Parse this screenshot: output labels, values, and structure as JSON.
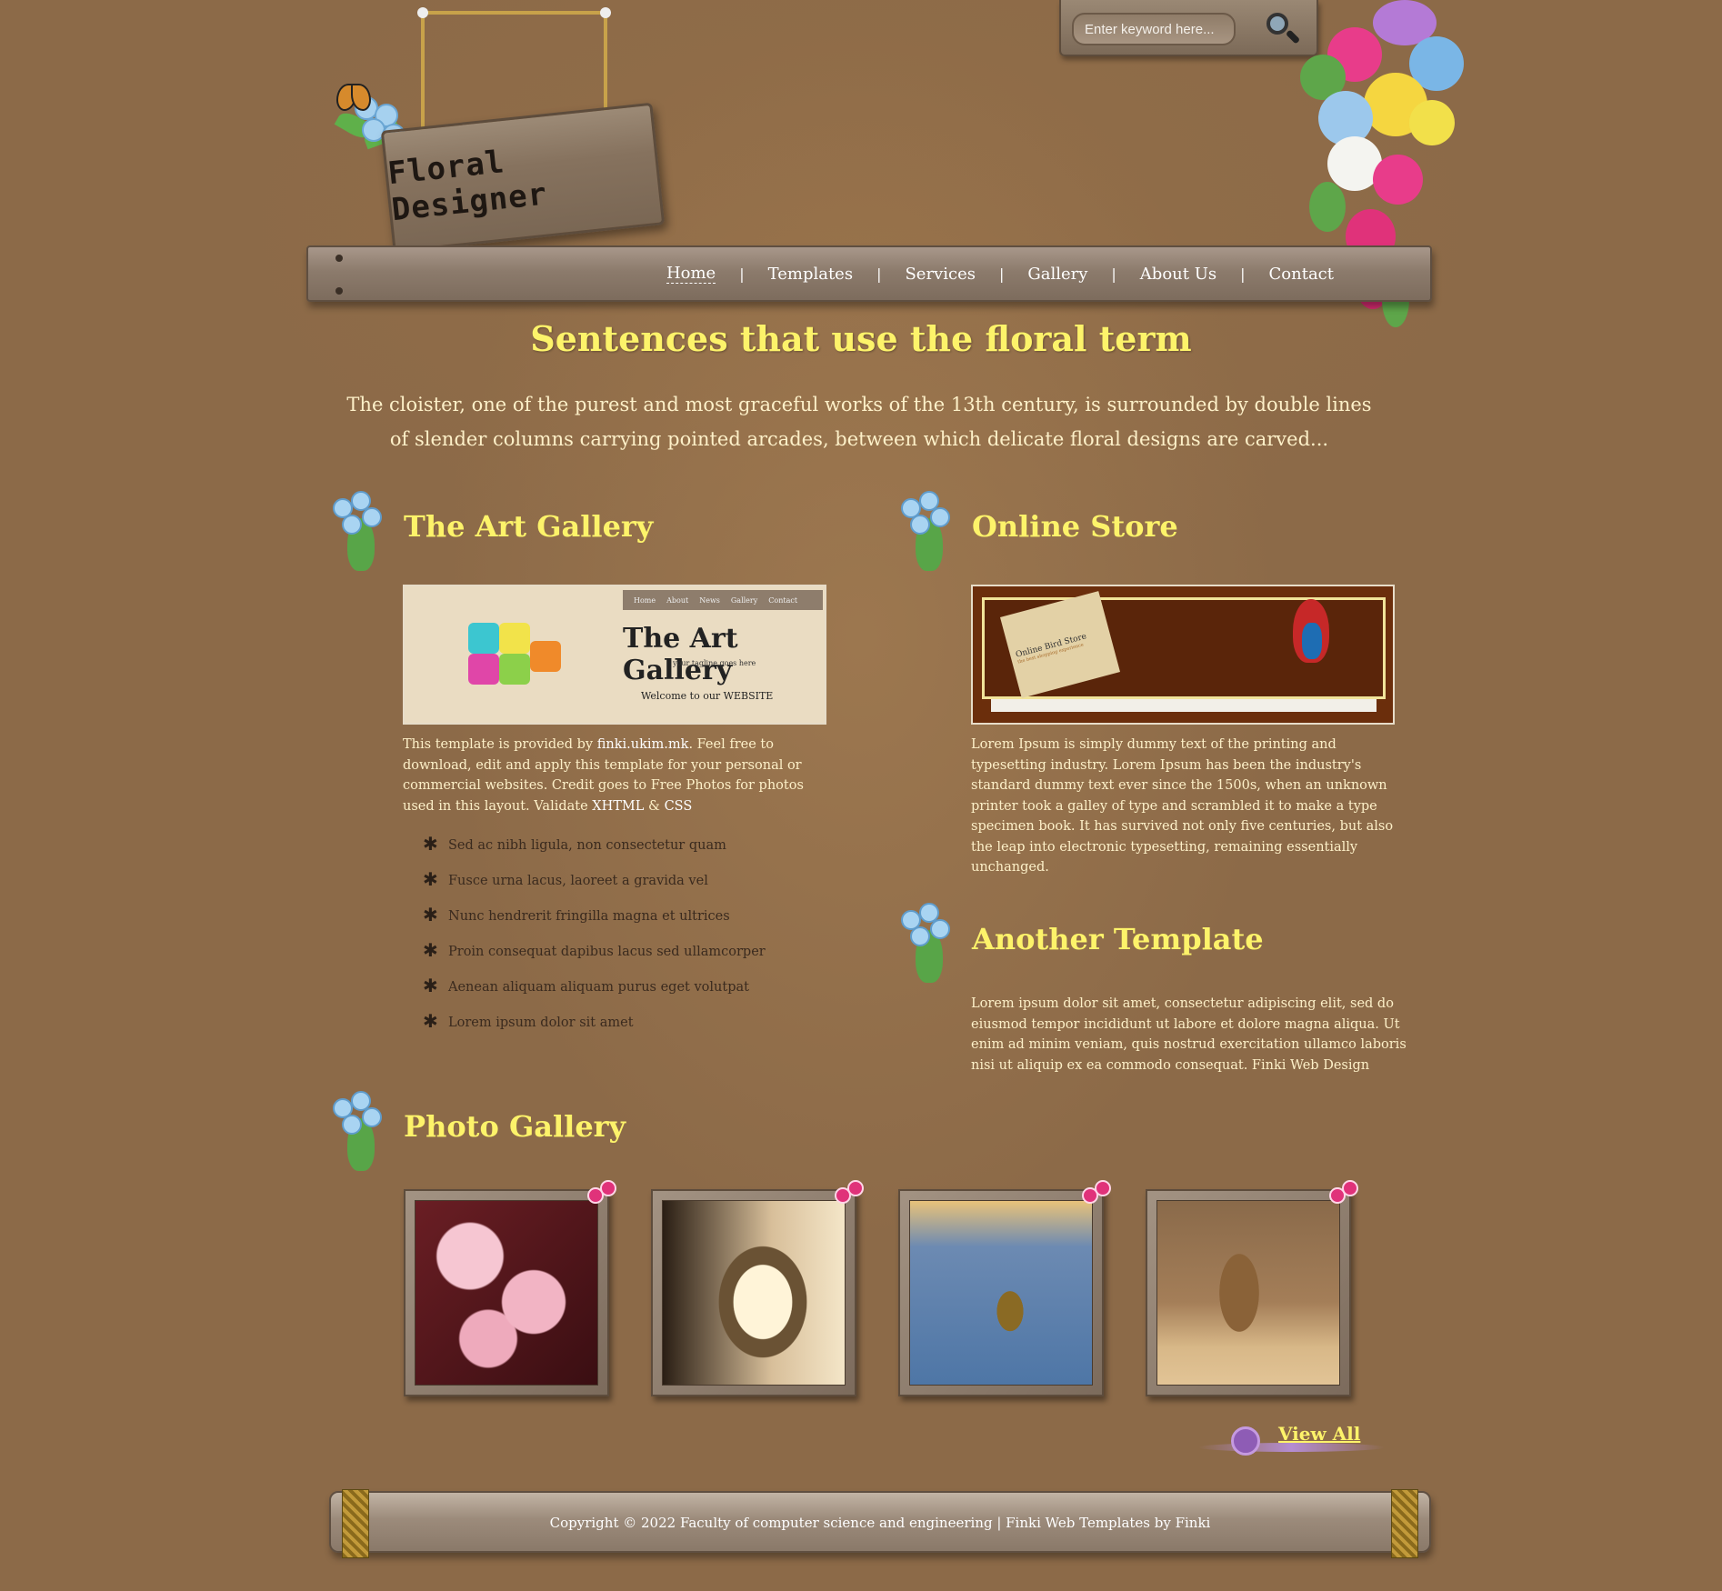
{
  "header": {
    "logo_text": "Floral Designer",
    "search_placeholder": "Enter keyword here...",
    "nav": [
      {
        "label": "Home",
        "active": true
      },
      {
        "label": "Templates"
      },
      {
        "label": "Services"
      },
      {
        "label": "Gallery"
      },
      {
        "label": "About Us"
      },
      {
        "label": "Contact"
      }
    ]
  },
  "intro": {
    "title": "Sentences that use the floral term",
    "text": "The cloister, one of the purest and most graceful works of the 13th century, is surrounded by double lines of slender columns carrying pointed arcades, between which delicate floral designs are carved..."
  },
  "art_gallery": {
    "title": "The Art Gallery",
    "thumb_title": "The Art Gallery",
    "thumb_tagline": "your tagline goes here",
    "thumb_welcome": "Welcome to our WEBSITE",
    "thumb_menu": [
      "Home",
      "About",
      "News",
      "Gallery",
      "Contact"
    ],
    "para_before": "This template is provided by ",
    "para_link": "finki.ukim.mk",
    "para_after": ". Feel free to download, edit and apply this template for your personal or commercial websites. Credit goes to Free Photos for photos used in this layout. Validate ",
    "para_link2": "XHTML",
    "para_amp": " & ",
    "para_link3": "CSS",
    "bullets": [
      "Sed ac nibh ligula, non consectetur quam",
      "Fusce urna lacus, laoreet a gravida vel",
      "Nunc hendrerit fringilla magna et ultrices",
      "Proin consequat dapibus lacus sed ullamcorper",
      "Aenean aliquam aliquam purus eget volutpat",
      "Lorem ipsum dolor sit amet"
    ]
  },
  "online_store": {
    "title": "Online Store",
    "thumb_note": "Online Bird Store",
    "thumb_note_sub": "the best shopping experience",
    "para": "Lorem Ipsum is simply dummy text of the printing and typesetting industry. Lorem Ipsum has been the industry's standard dummy text ever since the 1500s, when an unknown printer took a galley of type and scrambled it to make a type specimen book. It has survived not only five centuries, but also the leap into electronic typesetting, remaining essentially unchanged."
  },
  "another_template": {
    "title": "Another Template",
    "para": "Lorem ipsum dolor sit amet, consectetur adipiscing elit, sed do eiusmod tempor incididunt ut labore et dolore magna aliqua. Ut enim ad minim veniam, quis nostrud exercitation ullamco laboris nisi ut aliquip ex ea commodo consequat. Finki Web Design"
  },
  "photo_gallery": {
    "title": "Photo Gallery",
    "photos": [
      "cherry-blossom",
      "lantern",
      "boat-on-water",
      "prairie-dog"
    ],
    "view_all": "View All"
  },
  "footer": {
    "copyright": "Copyright © 2022 Faculty of computer science and engineering | Finki Web Templates by Finki"
  },
  "colors": {
    "background": "#8c6a48",
    "heading_yellow": "#fdf36a",
    "body_text": "#fdf0c8"
  }
}
